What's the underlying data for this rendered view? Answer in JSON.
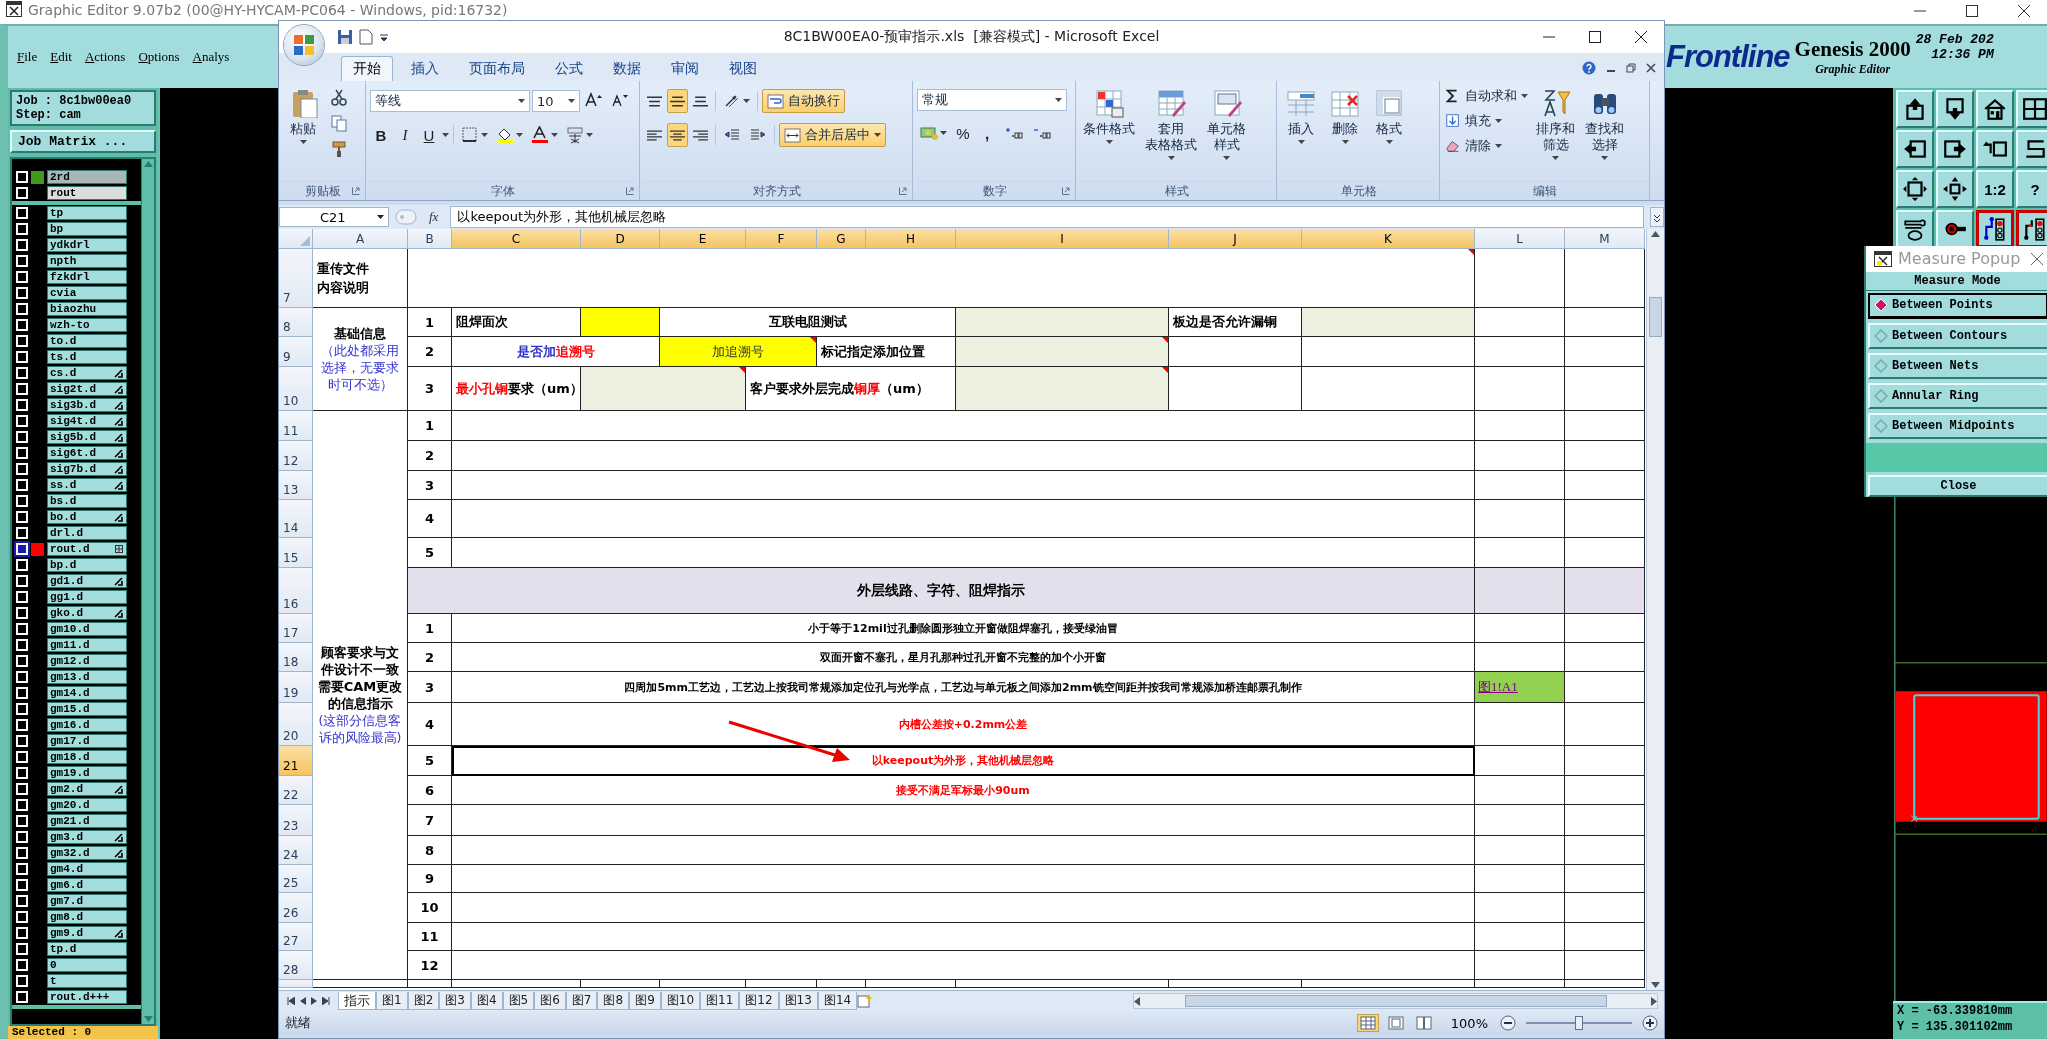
{
  "genesis": {
    "title": "Graphic Editor 9.07b2 (00@HY-HYCAM-PC064 - Windows, pid:16732)",
    "menu": [
      "File",
      "Edit",
      "Actions",
      "Options",
      "Analys"
    ],
    "job": "Job : 8c1bw00ea0",
    "step": "Step: cam",
    "job_matrix_button": "Job Matrix ...",
    "layer_groups": [
      [
        {
          "name": "2rd",
          "kind": "shaded",
          "color": "#3f9a1e",
          "selected": false,
          "pointer": false,
          "grid_mark": false
        },
        {
          "name": "rout",
          "kind": "light",
          "selected": false,
          "pointer": false,
          "grid_mark": false
        }
      ],
      [
        {
          "name": "tp",
          "kind": "plain",
          "selected": false,
          "pointer": false,
          "grid_mark": false
        },
        {
          "name": "bp",
          "kind": "plain",
          "selected": false,
          "pointer": false,
          "grid_mark": false
        },
        {
          "name": "ydkdrl",
          "kind": "plain",
          "selected": false,
          "pointer": false,
          "grid_mark": false
        },
        {
          "name": "npth",
          "kind": "plain",
          "selected": false,
          "pointer": false,
          "grid_mark": false
        },
        {
          "name": "fzkdrl",
          "kind": "plain",
          "selected": false,
          "pointer": false,
          "grid_mark": false
        },
        {
          "name": "cvia",
          "kind": "plain",
          "selected": false,
          "pointer": false,
          "grid_mark": false
        },
        {
          "name": "biaozhu",
          "kind": "plain",
          "selected": false,
          "pointer": false,
          "grid_mark": false
        },
        {
          "name": "wzh-to",
          "kind": "plain",
          "selected": false,
          "pointer": false,
          "grid_mark": false
        },
        {
          "name": "to.d",
          "kind": "plain",
          "selected": false,
          "pointer": false,
          "grid_mark": false
        },
        {
          "name": "ts.d",
          "kind": "plain",
          "selected": false,
          "pointer": false,
          "grid_mark": false
        },
        {
          "name": "cs.d",
          "kind": "plain",
          "selected": false,
          "pointer": true,
          "grid_mark": false
        },
        {
          "name": "sig2t.d",
          "kind": "plain",
          "selected": false,
          "pointer": true,
          "grid_mark": false
        },
        {
          "name": "sig3b.d",
          "kind": "plain",
          "selected": false,
          "pointer": true,
          "grid_mark": false
        },
        {
          "name": "sig4t.d",
          "kind": "plain",
          "selected": false,
          "pointer": true,
          "grid_mark": false
        },
        {
          "name": "sig5b.d",
          "kind": "plain",
          "selected": false,
          "pointer": true,
          "grid_mark": false
        },
        {
          "name": "sig6t.d",
          "kind": "plain",
          "selected": false,
          "pointer": true,
          "grid_mark": false
        },
        {
          "name": "sig7b.d",
          "kind": "plain",
          "selected": false,
          "pointer": true,
          "grid_mark": false
        },
        {
          "name": "ss.d",
          "kind": "plain",
          "selected": false,
          "pointer": true,
          "grid_mark": false
        },
        {
          "name": "bs.d",
          "kind": "plain",
          "selected": false,
          "pointer": false,
          "grid_mark": false
        },
        {
          "name": "bo.d",
          "kind": "plain",
          "selected": false,
          "pointer": true,
          "grid_mark": false
        },
        {
          "name": "drl.d",
          "kind": "plain",
          "selected": false,
          "pointer": false,
          "grid_mark": false
        },
        {
          "name": "rout.d",
          "kind": "plain",
          "color": "#ff0000",
          "selected": true,
          "pointer": false,
          "grid_mark": true
        },
        {
          "name": "bp.d",
          "kind": "plain",
          "selected": false,
          "pointer": false,
          "grid_mark": false
        },
        {
          "name": "gd1.d",
          "kind": "plain",
          "selected": false,
          "pointer": true,
          "grid_mark": false
        },
        {
          "name": "gg1.d",
          "kind": "plain",
          "selected": false,
          "pointer": false,
          "grid_mark": false
        },
        {
          "name": "gko.d",
          "kind": "plain",
          "selected": false,
          "pointer": true,
          "grid_mark": false
        },
        {
          "name": "gm10.d",
          "kind": "plain",
          "selected": false,
          "pointer": false,
          "grid_mark": false
        },
        {
          "name": "gm11.d",
          "kind": "plain",
          "selected": false,
          "pointer": false,
          "grid_mark": false
        },
        {
          "name": "gm12.d",
          "kind": "plain",
          "selected": false,
          "pointer": false,
          "grid_mark": false
        },
        {
          "name": "gm13.d",
          "kind": "plain",
          "selected": false,
          "pointer": false,
          "grid_mark": false
        },
        {
          "name": "gm14.d",
          "kind": "plain",
          "selected": false,
          "pointer": false,
          "grid_mark": false
        },
        {
          "name": "gm15.d",
          "kind": "plain",
          "selected": false,
          "pointer": false,
          "grid_mark": false
        },
        {
          "name": "gm16.d",
          "kind": "plain",
          "selected": false,
          "pointer": false,
          "grid_mark": false
        },
        {
          "name": "gm17.d",
          "kind": "plain",
          "selected": false,
          "pointer": false,
          "grid_mark": false
        },
        {
          "name": "gm18.d",
          "kind": "plain",
          "selected": false,
          "pointer": false,
          "grid_mark": false
        },
        {
          "name": "gm19.d",
          "kind": "plain",
          "selected": false,
          "pointer": false,
          "grid_mark": false
        },
        {
          "name": "gm2.d",
          "kind": "plain",
          "selected": false,
          "pointer": true,
          "grid_mark": false
        },
        {
          "name": "gm20.d",
          "kind": "plain",
          "selected": false,
          "pointer": false,
          "grid_mark": false
        },
        {
          "name": "gm21.d",
          "kind": "plain",
          "selected": false,
          "pointer": false,
          "grid_mark": false
        },
        {
          "name": "gm3.d",
          "kind": "plain",
          "selected": false,
          "pointer": true,
          "grid_mark": false
        },
        {
          "name": "gm32.d",
          "kind": "plain",
          "selected": false,
          "pointer": true,
          "grid_mark": false
        },
        {
          "name": "gm4.d",
          "kind": "plain",
          "selected": false,
          "pointer": false,
          "grid_mark": false
        },
        {
          "name": "gm6.d",
          "kind": "plain",
          "selected": false,
          "pointer": false,
          "grid_mark": false
        },
        {
          "name": "gm7.d",
          "kind": "plain",
          "selected": false,
          "pointer": false,
          "grid_mark": false
        },
        {
          "name": "gm8.d",
          "kind": "plain",
          "selected": false,
          "pointer": false,
          "grid_mark": false
        },
        {
          "name": "gm9.d",
          "kind": "plain",
          "selected": false,
          "pointer": true,
          "grid_mark": false
        },
        {
          "name": "tp.d",
          "kind": "plain",
          "selected": false,
          "pointer": false,
          "grid_mark": false
        },
        {
          "name": "0",
          "kind": "plain",
          "selected": false,
          "pointer": false,
          "grid_mark": false
        },
        {
          "name": "t",
          "kind": "plain",
          "selected": false,
          "pointer": false,
          "grid_mark": false
        },
        {
          "name": "rout.d+++",
          "kind": "plain",
          "selected": false,
          "pointer": false,
          "grid_mark": false
        }
      ]
    ],
    "selected_count": "Selected : 0",
    "brand": {
      "logo": "Frontline",
      "product": "Genesis 2000",
      "subtitle": "Graphic Editor",
      "date": "28 Feb 202",
      "time": "12:36 PM"
    },
    "toolbar": [
      {
        "kind": "icon",
        "selected": false
      },
      {
        "kind": "icon",
        "selected": false
      },
      {
        "kind": "icon",
        "selected": false
      },
      {
        "kind": "icon",
        "selected": false
      },
      {
        "kind": "icon",
        "selected": false
      },
      {
        "kind": "icon",
        "selected": false
      },
      {
        "kind": "icon",
        "selected": false
      },
      {
        "kind": "icon",
        "selected": false
      },
      {
        "kind": "icon",
        "selected": false
      },
      {
        "kind": "icon",
        "selected": false
      },
      {
        "kind": "text",
        "label": "1:2",
        "selected": false
      },
      {
        "kind": "text",
        "label": "?",
        "selected": false
      },
      {
        "kind": "icon",
        "selected": false
      },
      {
        "kind": "icon",
        "selected": false
      },
      {
        "kind": "icon",
        "selected": true
      },
      {
        "kind": "icon",
        "selected": true
      }
    ],
    "coordinates": {
      "x": "X = -63.339810mm",
      "y": "Y = 135.301102mm"
    }
  },
  "measure_popup": {
    "title": "Measure Popup",
    "heading": "Measure Mode",
    "modes": [
      {
        "label": "Between Points",
        "selected": true
      },
      {
        "label": "Between Contours",
        "selected": false
      },
      {
        "label": "Between Nets",
        "selected": false
      },
      {
        "label": "Annular Ring",
        "selected": false
      },
      {
        "label": "Between Midpoints",
        "selected": false
      }
    ],
    "close_button": "Close"
  },
  "excel": {
    "title": "8C1BW00EA0-预审指示.xls  [兼容模式] - Microsoft Excel",
    "tabs": [
      {
        "label": "开始",
        "selected": true
      },
      {
        "label": "插入",
        "selected": false
      },
      {
        "label": "页面布局",
        "selected": false
      },
      {
        "label": "公式",
        "selected": false
      },
      {
        "label": "数据",
        "selected": false
      },
      {
        "label": "审阅",
        "selected": false
      },
      {
        "label": "视图",
        "selected": false
      }
    ],
    "ribbon": {
      "clipboard": {
        "label": "剪贴板",
        "paste": "粘贴"
      },
      "font": {
        "label": "字体",
        "font_name": "等线",
        "font_size": "10",
        "bold": "B",
        "italic": "I",
        "underline": "U"
      },
      "alignment": {
        "label": "对齐方式",
        "align_buttons": [
          {
            "selected": false
          },
          {
            "selected": true
          },
          {
            "selected": false
          },
          {
            "selected": false
          },
          {
            "selected": true
          },
          {
            "selected": false
          }
        ],
        "wrap_text": {
          "label": "自动换行",
          "selected": true
        },
        "merge_center": {
          "label": "合并后居中",
          "selected": true
        }
      },
      "number": {
        "label": "数字",
        "format": "常规",
        "percent": "%",
        "comma": ","
      },
      "styles": {
        "label": "样式",
        "buttons": [
          [
            "条件格式"
          ],
          [
            "套用",
            "表格格式"
          ],
          [
            "单元格",
            "样式"
          ]
        ]
      },
      "cells": {
        "label": "单元格",
        "buttons": [
          [
            "插入"
          ],
          [
            "删除"
          ],
          [
            "格式"
          ]
        ]
      },
      "editing": {
        "label": "编辑",
        "small_buttons": [
          "自动求和",
          "填充",
          "清除"
        ],
        "large_buttons": [
          [
            "排序和",
            "筛选"
          ],
          [
            "查找和",
            "选择"
          ]
        ]
      }
    },
    "formula_bar": {
      "name_box": "C21",
      "function_label": "fx",
      "formula": "以keepout为外形，其他机械层忽略"
    },
    "sheet": {
      "columns": [
        {
          "label": "A",
          "selected": false
        },
        {
          "label": "B",
          "selected": false
        },
        {
          "label": "C",
          "selected": true
        },
        {
          "label": "D",
          "selected": true
        },
        {
          "label": "E",
          "selected": true
        },
        {
          "label": "F",
          "selected": true
        },
        {
          "label": "G",
          "selected": true
        },
        {
          "label": "H",
          "selected": true
        },
        {
          "label": "I",
          "selected": true
        },
        {
          "label": "J",
          "selected": true
        },
        {
          "label": "K",
          "selected": true
        },
        {
          "label": "L",
          "selected": false
        },
        {
          "label": "M",
          "selected": false
        }
      ],
      "rows": [
        {
          "label": "7",
          "selected": false
        },
        {
          "label": "8",
          "selected": false
        },
        {
          "label": "9",
          "selected": false
        },
        {
          "label": "10",
          "selected": false
        },
        {
          "label": "11",
          "selected": false
        },
        {
          "label": "12",
          "selected": false
        },
        {
          "label": "13",
          "selected": false
        },
        {
          "label": "14",
          "selected": false
        },
        {
          "label": "15",
          "selected": false
        },
        {
          "label": "16",
          "selected": false
        },
        {
          "label": "17",
          "selected": false
        },
        {
          "label": "18",
          "selected": false
        },
        {
          "label": "19",
          "selected": false
        },
        {
          "label": "20",
          "selected": false
        },
        {
          "label": "21",
          "selected": true
        },
        {
          "label": "22",
          "selected": false
        },
        {
          "label": "23",
          "selected": false
        },
        {
          "label": "24",
          "selected": false
        },
        {
          "label": "25",
          "selected": false
        },
        {
          "label": "26",
          "selected": false
        },
        {
          "label": "27",
          "selected": false
        },
        {
          "label": "28",
          "selected": false
        }
      ],
      "cells": [
        {
          "kind": "title",
          "lines": [
            "重传文件",
            "内容说明"
          ],
          "selected": false
        },
        {
          "kind": "blank",
          "comment": true,
          "selected": false
        },
        {
          "kind": "group",
          "parts": [
            {
              "text": "基础信息",
              "color": "#000000"
            },
            {
              "text": "（此处都采用选择，无要求时可不选）",
              "color": "#3333cc"
            }
          ],
          "selected": false
        },
        {
          "kind": "index",
          "text": "1",
          "selected": false
        },
        {
          "kind": "field",
          "text": "阻焊面次",
          "selected": false
        },
        {
          "kind": "blank",
          "color": "#ffff00",
          "selected": false
        },
        {
          "kind": "center",
          "text": "互联电阻测试",
          "selected": false
        },
        {
          "kind": "blank",
          "color": "#ebf1de",
          "selected": false
        },
        {
          "kind": "field",
          "text": "板边是否允许漏铜",
          "selected": false
        },
        {
          "kind": "blank",
          "color": "#ebf1de",
          "selected": false
        },
        {
          "kind": "index",
          "text": "2",
          "selected": false
        },
        {
          "kind": "center",
          "parts": [
            {
              "text": "是否加",
              "color": "#3333cc"
            },
            {
              "text": "追溯号",
              "color": "#ff0000"
            }
          ],
          "selected": false
        },
        {
          "kind": "value",
          "text": "加追溯号",
          "color": "#ffff00",
          "comment": true,
          "selected": false
        },
        {
          "kind": "field",
          "text": "标记指定添加位置",
          "selected": false
        },
        {
          "kind": "blank",
          "color": "#ebf1de",
          "comment": true,
          "selected": false
        },
        {
          "kind": "index",
          "text": "3",
          "selected": false
        },
        {
          "kind": "field",
          "parts": [
            {
              "text": "最小孔铜",
              "color": "#ff0000"
            },
            {
              "text": "要求（um）",
              "color": "#000000"
            }
          ],
          "selected": false
        },
        {
          "kind": "blank",
          "color": "#ebf1de",
          "comment": true,
          "selected": false
        },
        {
          "kind": "field",
          "parts": [
            {
              "text": "客户要求外层完成",
              "color": "#000000"
            },
            {
              "text": "铜厚",
              "color": "#ff0000"
            },
            {
              "text": "（um）",
              "color": "#000000"
            }
          ],
          "selected": false
        },
        {
          "kind": "blank",
          "color": "#ebf1de",
          "comment": true,
          "selected": false
        },
        {
          "kind": "group",
          "parts": [
            {
              "text": "顾客要求与文件设计不一致需要CAM更改的信息指示",
              "color": "#000000"
            },
            {
              "text": "(这部分信息客诉的风险最高)",
              "color": "#3333cc"
            }
          ],
          "selected": false
        },
        {
          "kind": "index",
          "text": "1",
          "selected": false
        },
        {
          "kind": "blank",
          "selected": false
        },
        {
          "kind": "index",
          "text": "2",
          "selected": false
        },
        {
          "kind": "blank",
          "selected": false
        },
        {
          "kind": "index",
          "text": "3",
          "selected": false
        },
        {
          "kind": "blank",
          "selected": false
        },
        {
          "kind": "index",
          "text": "4",
          "selected": false
        },
        {
          "kind": "blank",
          "selected": false
        },
        {
          "kind": "index",
          "text": "5",
          "selected": false
        },
        {
          "kind": "blank",
          "selected": false
        },
        {
          "kind": "section",
          "text": "外层线路、字符、阻焊指示",
          "color": "#e4dfec",
          "selected": false
        },
        {
          "kind": "blank",
          "color": "#e4dfec",
          "selected": false
        },
        {
          "kind": "blank",
          "color": "#e4dfec",
          "selected": false
        },
        {
          "kind": "index",
          "text": "1",
          "selected": false
        },
        {
          "kind": "note",
          "parts": [
            {
              "text": "小于等于12mil过孔删除圆形独立开窗做阻焊塞孔，接受绿油冒",
              "color": "#000000"
            }
          ],
          "selected": false
        },
        {
          "kind": "index",
          "text": "2",
          "selected": false
        },
        {
          "kind": "note",
          "parts": [
            {
              "text": "双面开窗不塞孔，星月孔那种过孔开窗不完整的加个小开窗",
              "color": "#000000"
            }
          ],
          "selected": false
        },
        {
          "kind": "index",
          "text": "3",
          "selected": false
        },
        {
          "kind": "note",
          "parts": [
            {
              "text": "四周加5mm工艺边，工艺边上按我司常规添加定位孔与光学点，工艺边与单元板之间添加2mm铣空间距并按我司常规添加桥连邮票孔制作",
              "color": "#000000"
            }
          ],
          "selected": false
        },
        {
          "kind": "link",
          "text": "图1!A1",
          "color": "#92d050",
          "selected": false
        },
        {
          "kind": "index",
          "text": "4",
          "selected": false
        },
        {
          "kind": "note",
          "parts": [
            {
              "text": "内槽公差按+0.2mm公差",
              "color": "#ff0000"
            }
          ],
          "selected": false
        },
        {
          "kind": "index",
          "text": "5",
          "selected": false
        },
        {
          "kind": "note",
          "parts": [
            {
              "text": "以keepout为外形，其他机械层忽略",
              "color": "#ff0000"
            }
          ],
          "selected": true
        },
        {
          "kind": "index",
          "text": "6",
          "selected": false
        },
        {
          "kind": "note",
          "parts": [
            {
              "text": "接受不满足军标最小90um",
              "color": "#ff0000"
            }
          ],
          "selected": false
        },
        {
          "kind": "index",
          "text": "7",
          "selected": false
        },
        {
          "kind": "blank",
          "selected": false
        },
        {
          "kind": "index",
          "text": "8",
          "selected": false
        },
        {
          "kind": "blank",
          "selected": false
        },
        {
          "kind": "index",
          "text": "9",
          "selected": false
        },
        {
          "kind": "blank",
          "selected": false
        },
        {
          "kind": "index",
          "text": "10",
          "selected": false
        },
        {
          "kind": "blank",
          "selected": false
        },
        {
          "kind": "index",
          "text": "11",
          "selected": false
        },
        {
          "kind": "blank",
          "selected": false
        },
        {
          "kind": "index",
          "text": "12",
          "selected": false
        },
        {
          "kind": "blank",
          "selected": false
        }
      ],
      "arrow_mark": true
    },
    "sheet_tabs": [
      {
        "label": "指示",
        "selected": true
      },
      {
        "label": "图1",
        "selected": false
      },
      {
        "label": "图2",
        "selected": false
      },
      {
        "label": "图3",
        "selected": false
      },
      {
        "label": "图4",
        "selected": false
      },
      {
        "label": "图5",
        "selected": false
      },
      {
        "label": "图6",
        "selected": false
      },
      {
        "label": "图7",
        "selected": false
      },
      {
        "label": "图8",
        "selected": false
      },
      {
        "label": "图9",
        "selected": false
      },
      {
        "label": "图10",
        "selected": false
      },
      {
        "label": "图11",
        "selected": false
      },
      {
        "label": "图12",
        "selected": false
      },
      {
        "label": "图13",
        "selected": false
      },
      {
        "label": "图14",
        "selected": false
      }
    ],
    "status": {
      "text": "就绪",
      "views": [
        {
          "selected": true
        },
        {
          "selected": false
        },
        {
          "selected": false
        }
      ],
      "zoom": "100%",
      "zoom_slider": {
        "level": 0.5
      }
    }
  }
}
